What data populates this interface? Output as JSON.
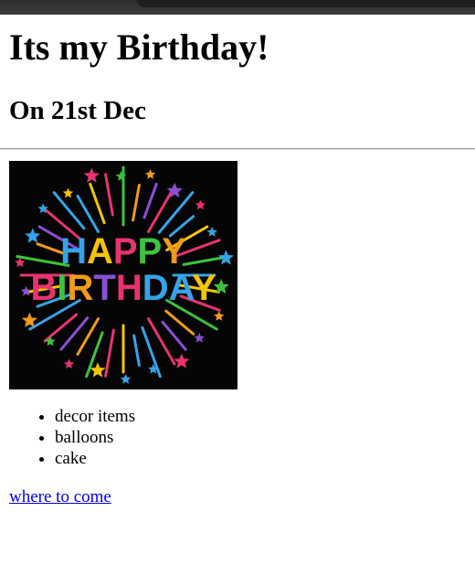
{
  "page": {
    "heading": "Its my Birthday!",
    "subheading": "On 21st Dec"
  },
  "banner": {
    "line1": "HAPPY",
    "line2": "BIRTHDAY",
    "background": "#050505",
    "letter_colors": [
      "#34a4e8",
      "#f5c400",
      "#e8336f",
      "#3cc43c",
      "#f29a1a",
      "#8a4fd6",
      "#e8336f",
      "#34a4e8"
    ]
  },
  "list": {
    "items": [
      "decor items",
      "balloons",
      "cake"
    ]
  },
  "link": {
    "label": "where to come"
  }
}
